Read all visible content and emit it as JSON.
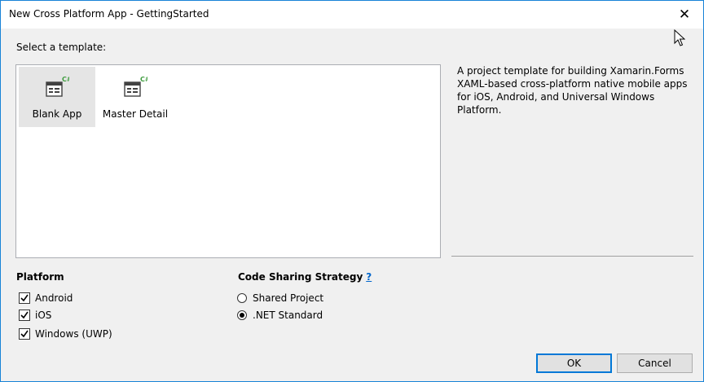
{
  "window": {
    "title": "New Cross Platform App - GettingStarted",
    "close_glyph": "✕"
  },
  "template_section": {
    "label": "Select a template:",
    "templates": [
      {
        "label": "Blank App",
        "selected": true,
        "icon": "xamarin-forms-template-icon"
      },
      {
        "label": "Master Detail",
        "selected": false,
        "icon": "xamarin-forms-template-icon"
      }
    ],
    "description": "A project template for building Xamarin.Forms XAML-based cross-platform native mobile apps for iOS, Android, and Universal Windows Platform."
  },
  "platform": {
    "title": "Platform",
    "options": [
      {
        "label": "Android",
        "checked": true
      },
      {
        "label": "iOS",
        "checked": true
      },
      {
        "label": "Windows (UWP)",
        "checked": true
      }
    ]
  },
  "code_sharing": {
    "title": "Code Sharing Strategy",
    "help": "?",
    "options": [
      {
        "label": "Shared Project",
        "selected": false
      },
      {
        "label": ".NET Standard",
        "selected": true
      }
    ]
  },
  "buttons": {
    "ok": "OK",
    "cancel": "Cancel"
  },
  "colors": {
    "accent": "#0078d7",
    "window_border": "#1883d7",
    "csharp_badge": "#3c9b3c"
  }
}
